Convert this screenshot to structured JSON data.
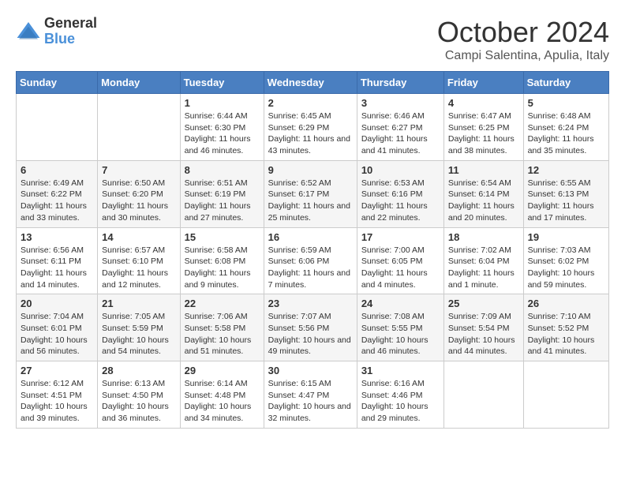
{
  "logo": {
    "general": "General",
    "blue": "Blue"
  },
  "title": "October 2024",
  "location": "Campi Salentina, Apulia, Italy",
  "days_of_week": [
    "Sunday",
    "Monday",
    "Tuesday",
    "Wednesday",
    "Thursday",
    "Friday",
    "Saturday"
  ],
  "weeks": [
    [
      {
        "day": "",
        "content": ""
      },
      {
        "day": "",
        "content": ""
      },
      {
        "day": "1",
        "content": "Sunrise: 6:44 AM\nSunset: 6:30 PM\nDaylight: 11 hours and 46 minutes."
      },
      {
        "day": "2",
        "content": "Sunrise: 6:45 AM\nSunset: 6:29 PM\nDaylight: 11 hours and 43 minutes."
      },
      {
        "day": "3",
        "content": "Sunrise: 6:46 AM\nSunset: 6:27 PM\nDaylight: 11 hours and 41 minutes."
      },
      {
        "day": "4",
        "content": "Sunrise: 6:47 AM\nSunset: 6:25 PM\nDaylight: 11 hours and 38 minutes."
      },
      {
        "day": "5",
        "content": "Sunrise: 6:48 AM\nSunset: 6:24 PM\nDaylight: 11 hours and 35 minutes."
      }
    ],
    [
      {
        "day": "6",
        "content": "Sunrise: 6:49 AM\nSunset: 6:22 PM\nDaylight: 11 hours and 33 minutes."
      },
      {
        "day": "7",
        "content": "Sunrise: 6:50 AM\nSunset: 6:20 PM\nDaylight: 11 hours and 30 minutes."
      },
      {
        "day": "8",
        "content": "Sunrise: 6:51 AM\nSunset: 6:19 PM\nDaylight: 11 hours and 27 minutes."
      },
      {
        "day": "9",
        "content": "Sunrise: 6:52 AM\nSunset: 6:17 PM\nDaylight: 11 hours and 25 minutes."
      },
      {
        "day": "10",
        "content": "Sunrise: 6:53 AM\nSunset: 6:16 PM\nDaylight: 11 hours and 22 minutes."
      },
      {
        "day": "11",
        "content": "Sunrise: 6:54 AM\nSunset: 6:14 PM\nDaylight: 11 hours and 20 minutes."
      },
      {
        "day": "12",
        "content": "Sunrise: 6:55 AM\nSunset: 6:13 PM\nDaylight: 11 hours and 17 minutes."
      }
    ],
    [
      {
        "day": "13",
        "content": "Sunrise: 6:56 AM\nSunset: 6:11 PM\nDaylight: 11 hours and 14 minutes."
      },
      {
        "day": "14",
        "content": "Sunrise: 6:57 AM\nSunset: 6:10 PM\nDaylight: 11 hours and 12 minutes."
      },
      {
        "day": "15",
        "content": "Sunrise: 6:58 AM\nSunset: 6:08 PM\nDaylight: 11 hours and 9 minutes."
      },
      {
        "day": "16",
        "content": "Sunrise: 6:59 AM\nSunset: 6:06 PM\nDaylight: 11 hours and 7 minutes."
      },
      {
        "day": "17",
        "content": "Sunrise: 7:00 AM\nSunset: 6:05 PM\nDaylight: 11 hours and 4 minutes."
      },
      {
        "day": "18",
        "content": "Sunrise: 7:02 AM\nSunset: 6:04 PM\nDaylight: 11 hours and 1 minute."
      },
      {
        "day": "19",
        "content": "Sunrise: 7:03 AM\nSunset: 6:02 PM\nDaylight: 10 hours and 59 minutes."
      }
    ],
    [
      {
        "day": "20",
        "content": "Sunrise: 7:04 AM\nSunset: 6:01 PM\nDaylight: 10 hours and 56 minutes."
      },
      {
        "day": "21",
        "content": "Sunrise: 7:05 AM\nSunset: 5:59 PM\nDaylight: 10 hours and 54 minutes."
      },
      {
        "day": "22",
        "content": "Sunrise: 7:06 AM\nSunset: 5:58 PM\nDaylight: 10 hours and 51 minutes."
      },
      {
        "day": "23",
        "content": "Sunrise: 7:07 AM\nSunset: 5:56 PM\nDaylight: 10 hours and 49 minutes."
      },
      {
        "day": "24",
        "content": "Sunrise: 7:08 AM\nSunset: 5:55 PM\nDaylight: 10 hours and 46 minutes."
      },
      {
        "day": "25",
        "content": "Sunrise: 7:09 AM\nSunset: 5:54 PM\nDaylight: 10 hours and 44 minutes."
      },
      {
        "day": "26",
        "content": "Sunrise: 7:10 AM\nSunset: 5:52 PM\nDaylight: 10 hours and 41 minutes."
      }
    ],
    [
      {
        "day": "27",
        "content": "Sunrise: 6:12 AM\nSunset: 4:51 PM\nDaylight: 10 hours and 39 minutes."
      },
      {
        "day": "28",
        "content": "Sunrise: 6:13 AM\nSunset: 4:50 PM\nDaylight: 10 hours and 36 minutes."
      },
      {
        "day": "29",
        "content": "Sunrise: 6:14 AM\nSunset: 4:48 PM\nDaylight: 10 hours and 34 minutes."
      },
      {
        "day": "30",
        "content": "Sunrise: 6:15 AM\nSunset: 4:47 PM\nDaylight: 10 hours and 32 minutes."
      },
      {
        "day": "31",
        "content": "Sunrise: 6:16 AM\nSunset: 4:46 PM\nDaylight: 10 hours and 29 minutes."
      },
      {
        "day": "",
        "content": ""
      },
      {
        "day": "",
        "content": ""
      }
    ]
  ]
}
